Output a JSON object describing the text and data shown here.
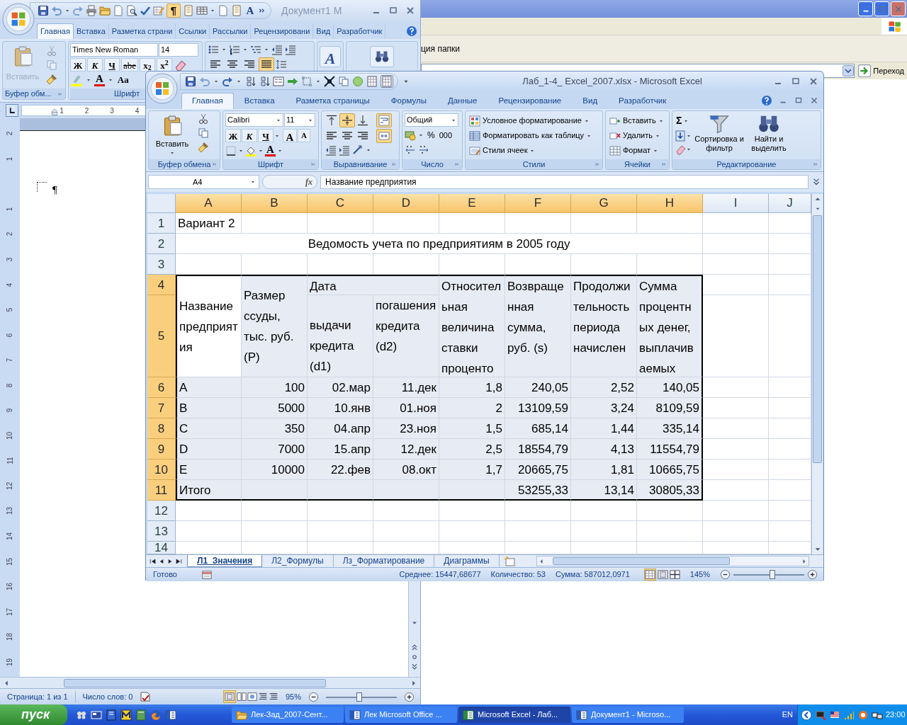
{
  "explorer": {
    "toolbar_text": "ция папки",
    "go_button": "Переход"
  },
  "word": {
    "title": "Документ1 М",
    "qat": {
      "pilcrow": {
        "label": "¶",
        "on": true
      },
      "letter": "A"
    },
    "tabs": [
      {
        "label": "Главная",
        "selected": true
      },
      {
        "label": "Вставка",
        "selected": false
      },
      {
        "label": "Разметка страни",
        "selected": false
      },
      {
        "label": "Ссылки",
        "selected": false
      },
      {
        "label": "Рассылки",
        "selected": false
      },
      {
        "label": "Рецензировани",
        "selected": false
      },
      {
        "label": "Вид",
        "selected": false
      },
      {
        "label": "Разработчик",
        "selected": false
      }
    ],
    "ribbon": {
      "paste": {
        "label": "Вставить",
        "disabled": true
      },
      "clipboard_label": "Буфер обм...",
      "font_name": "Times New Roman",
      "font_size": "14",
      "format_buttons": [
        "Ж",
        "К",
        "Ч",
        "abe",
        "x$_{2}$",
        "x$^{2}$"
      ],
      "font_color": "A",
      "change_case": "Aa",
      "font_label": "Шрифт",
      "align_buttons": [
        {
          "on": false
        },
        {
          "on": false
        },
        {
          "on": false
        },
        {
          "on": true
        }
      ],
      "styles_glyph": "A"
    },
    "ruler": [
      "1",
      "2",
      "3",
      "4"
    ],
    "vertical_ruler": {
      "above": [
        "2",
        "1"
      ],
      "below": [
        "1",
        "2",
        "3",
        "4",
        "5",
        "6",
        "7",
        "8",
        "9",
        "10",
        "11",
        "12",
        "13",
        "14",
        "15",
        "16",
        "17",
        "18",
        "19"
      ]
    },
    "paragraph_mark": "¶",
    "status": {
      "page": "Страница: 1 из 1",
      "words": "Число слов: 0",
      "zoom": "95%",
      "zoom_slider": {
        "level": 0.47
      }
    }
  },
  "excel": {
    "title": "Лаб_1-4_ Excel_2007.xlsx - Microsoft Excel",
    "tabs": [
      {
        "label": "Главная",
        "selected": true
      },
      {
        "label": "Вставка",
        "selected": false
      },
      {
        "label": "Разметка страницы",
        "selected": false
      },
      {
        "label": "Формулы",
        "selected": false
      },
      {
        "label": "Данные",
        "selected": false
      },
      {
        "label": "Рецензирование",
        "selected": false
      },
      {
        "label": "Вид",
        "selected": false
      },
      {
        "label": "Разработчик",
        "selected": false
      }
    ],
    "ribbon": {
      "paste": {
        "label": "Вставить",
        "disabled": false
      },
      "clipboard_label": "Буфер обмена",
      "font_name": "Calibri",
      "font_size": "11",
      "format_buttons": [
        "Ж",
        "К",
        "Ч"
      ],
      "grow_font": "A",
      "shrink_font": "A",
      "font_color": "A",
      "font_label": "Шрифт",
      "alignment_buttons": [
        {
          "on": false
        },
        {
          "on": true
        },
        {
          "on": false
        },
        {
          "on": true
        },
        {
          "on": false
        },
        {
          "on": false
        },
        {
          "on": false
        },
        {
          "on": true
        }
      ],
      "alignment_label": "Выравнивание",
      "number_format": "Общий",
      "percent": "%",
      "thousands": "000",
      "number_label": "Число",
      "styles": [
        "Условное форматирование",
        "Форматировать как таблицу",
        "Стили ячеек"
      ],
      "styles_label": "Стили",
      "cells": [
        "Вставить",
        "Удалить",
        "Формат"
      ],
      "cells_label": "Ячейки",
      "sum": "Σ",
      "sort_filter": "Сортировка и фильтр",
      "find_select": "Найти и выделить",
      "editing_label": "Редактирование"
    },
    "name_box": "A4",
    "fx": "fx",
    "formula": "Название предприятия",
    "sheet": {
      "columns": [
        {
          "label": "A",
          "selected": true
        },
        {
          "label": "B",
          "selected": true
        },
        {
          "label": "C",
          "selected": true
        },
        {
          "label": "D",
          "selected": true
        },
        {
          "label": "E",
          "selected": true
        },
        {
          "label": "F",
          "selected": true
        },
        {
          "label": "G",
          "selected": true
        },
        {
          "label": "H",
          "selected": true
        },
        {
          "label": "I",
          "selected": false
        },
        {
          "label": "J",
          "selected": false
        }
      ],
      "rows": [
        {
          "label": "1",
          "selected": false
        },
        {
          "label": "2",
          "selected": false
        },
        {
          "label": "3",
          "selected": false
        },
        {
          "label": "4",
          "selected": true
        },
        {
          "label": "5",
          "selected": true
        },
        {
          "label": "6",
          "selected": true
        },
        {
          "label": "7",
          "selected": true
        },
        {
          "label": "8",
          "selected": true
        },
        {
          "label": "9",
          "selected": true
        },
        {
          "label": "10",
          "selected": true
        },
        {
          "label": "11",
          "selected": true
        },
        {
          "label": "12",
          "selected": false
        },
        {
          "label": "13",
          "selected": false
        },
        {
          "label": "14",
          "selected": false
        }
      ],
      "title_cell": "Вариант 2",
      "heading": "Ведомость учета по предприятиям в 2005 году",
      "table_header": {
        "name": "Название предприятия",
        "loan": "Размер ссуды, тыс. руб.(P)",
        "date": "Дата",
        "issue": "выдачи кредита (d1)",
        "repay": "погашения кредита (d2)",
        "rate": "Относительная величина ставки проценто",
        "returned": "Возвращенная сумма, руб. (s)",
        "duration": "Продолжительность периода начислен",
        "interest": "Сумма процентных денег, выплачиваемых"
      },
      "data_rows": [
        [
          "A",
          "100",
          "02.мар",
          "11.дек",
          "1,8",
          "240,05",
          "2,52",
          "140,05"
        ],
        [
          "B",
          "5000",
          "10.янв",
          "01.ноя",
          "2",
          "13109,59",
          "3,24",
          "8109,59"
        ],
        [
          "C",
          "350",
          "04.апр",
          "23.ноя",
          "1,5",
          "685,14",
          "1,44",
          "335,14"
        ],
        [
          "D",
          "7000",
          "15.апр",
          "12.дек",
          "2,5",
          "18554,79",
          "4,13",
          "11554,79"
        ],
        [
          "E",
          "10000",
          "22.фев",
          "08.окт",
          "1,7",
          "20665,75",
          "1,81",
          "10665,75"
        ]
      ],
      "total_row": {
        "label": "Итого",
        "values": [
          "53255,33",
          "13,14",
          "30805,33"
        ]
      }
    },
    "sheet_tabs": [
      {
        "label": "Л1_Значения",
        "selected": true
      },
      {
        "label": "Л2_Формулы",
        "selected": false
      },
      {
        "label": "Лз_Форматирование",
        "selected": false
      },
      {
        "label": "Диаграммы",
        "selected": false
      }
    ],
    "status": {
      "ready": "Готово",
      "average": "Среднее: 15447,68677",
      "count": "Количество: 53",
      "sum": "Сумма: 587012,0971",
      "zoom": "145%",
      "zoom_slider": {
        "level": 0.55
      }
    }
  },
  "taskbar": {
    "start": "пуск",
    "tasks": [
      {
        "label": "Лек-Зад_2007-Сент...",
        "selected": false
      },
      {
        "label": "Лек Microsoft Office ...",
        "selected": false
      },
      {
        "label": "Microsoft Excel - Лаб...",
        "selected": true
      },
      {
        "label": "Документ1 - Microso...",
        "selected": false
      }
    ],
    "language": "EN",
    "clock": "23:00"
  }
}
